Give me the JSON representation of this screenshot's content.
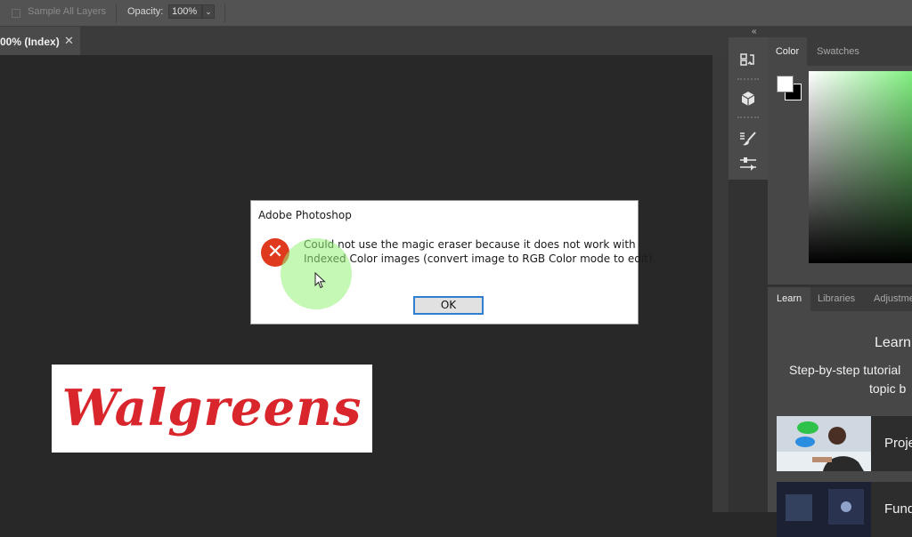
{
  "options_bar": {
    "sample_all_layers": "Sample All Layers",
    "opacity_label": "Opacity:",
    "opacity_value": "100%"
  },
  "document": {
    "tab_label": "00% (Index)",
    "close_glyph": "✕"
  },
  "canvas": {
    "logo_text": "Walgreens",
    "logo_color": "#d9262c"
  },
  "dock": {
    "collapse_glyph": "«",
    "tools": [
      "history-icon",
      "3d-icon",
      "brush-presets-icon",
      "properties-icon"
    ]
  },
  "color_panel": {
    "tabs": [
      "Color",
      "Swatches"
    ],
    "active_tab": "Color",
    "foreground": "#ffffff",
    "background": "#000000"
  },
  "learn_panel": {
    "tabs": [
      "Learn",
      "Libraries",
      "Adjustme"
    ],
    "heading": "Learn",
    "subtitle_line1": "Step-by-step tutorial",
    "subtitle_line2": "topic b",
    "cards": [
      {
        "label": "Proje"
      },
      {
        "label": "Fund"
      }
    ]
  },
  "dialog": {
    "title": "Adobe Photoshop",
    "icon": "error-icon",
    "icon_glyph": "✕",
    "message_line1": "Could not use the magic eraser because it does not work with",
    "message_line2": "Indexed Color images (convert image to RGB Color mode to edit).",
    "ok_label": "OK",
    "accent": "#2f7fd1"
  }
}
